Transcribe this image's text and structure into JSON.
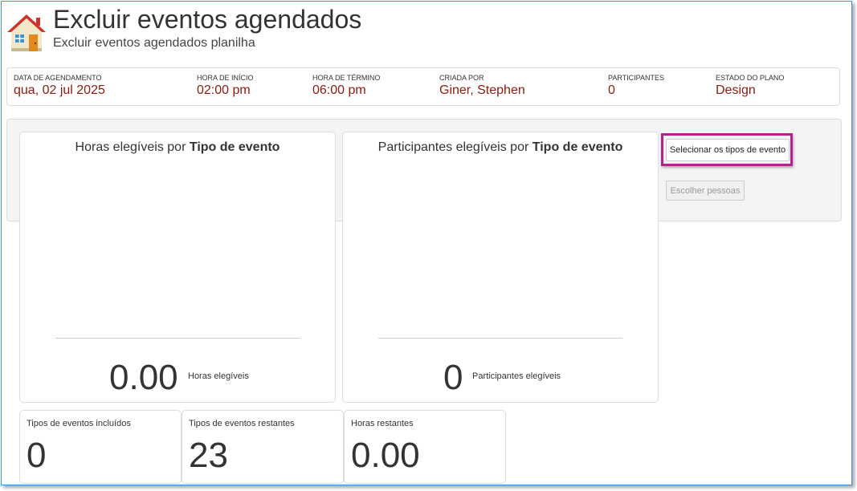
{
  "header": {
    "title": "Excluir eventos agendados",
    "subtitle": "Excluir eventos agendados planilha",
    "icon": "house-icon"
  },
  "info_bar": [
    {
      "label": "DATA DE AGENDAMENTO",
      "value": "qua, 02 jul 2025"
    },
    {
      "label": "HORA DE INÍCIO",
      "value": "02:00 pm"
    },
    {
      "label": "HORA DE TÉRMINO",
      "value": "06:00 pm"
    },
    {
      "label": "CRIADA POR",
      "value": "Giner, Stephen"
    },
    {
      "label": "PARTICIPANTES",
      "value": "0"
    },
    {
      "label": "ESTADO DO PLANO",
      "value": "Design"
    }
  ],
  "cards": {
    "hours": {
      "title_prefix": "Horas elegíveis por ",
      "title_bold": "Tipo de evento",
      "value": "0.00",
      "caption": "Horas elegíveis"
    },
    "participants": {
      "title_prefix": "Participantes elegíveis por ",
      "title_bold": "Tipo de evento",
      "value": "0",
      "caption": "Participantes elegíveis"
    }
  },
  "buttons": {
    "select_event_types": "Selecionar os tipos de evento",
    "choose_people": "Escolher pessoas"
  },
  "stats": [
    {
      "label": "Tipos de eventos incluídos",
      "value": "0"
    },
    {
      "label": "Tipos de eventos restantes",
      "value": "23"
    },
    {
      "label": "Horas restantes",
      "value": "0.00"
    }
  ],
  "colors": {
    "value_text": "#8b1a10",
    "highlight": "#b5228f",
    "frame": "#4a8fd0"
  }
}
